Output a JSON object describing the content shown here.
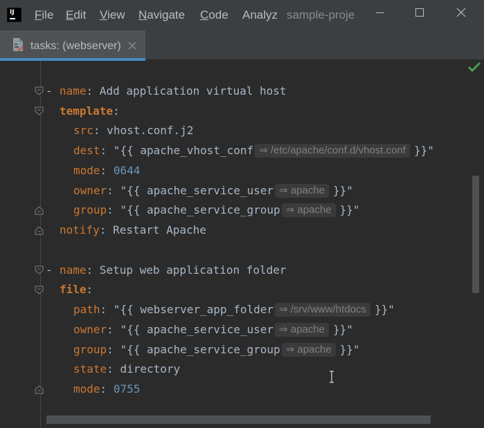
{
  "titlebar": {
    "logo_text": "IJ",
    "menu": {
      "file": {
        "mnemonic": "F",
        "rest": "ile"
      },
      "edit": {
        "mnemonic": "E",
        "rest": "dit"
      },
      "view": {
        "mnemonic": "V",
        "rest": "iew"
      },
      "navigate": {
        "mnemonic": "N",
        "rest": "avigate"
      },
      "code": {
        "mnemonic": "C",
        "rest": "ode"
      },
      "analyze": "Analyz"
    },
    "project_name": "sample-proje"
  },
  "tab": {
    "label": "tasks: (webserver)",
    "icon": "yaml-file-icon",
    "close_icon": "close-icon"
  },
  "colors": {
    "accent": "#4a88c7",
    "key": "#cc7832",
    "number": "#6897bb",
    "text": "#a9b7c6",
    "check": "#499c54"
  },
  "code": {
    "task1": {
      "dash": "-",
      "name_key": "name",
      "name_value": " Add application virtual host",
      "module": "template",
      "src_key": "src",
      "src_value": " vhost.conf.j2",
      "dest_key": "dest",
      "dest_pre": " \"{{ apache_vhost_conf",
      "dest_hint": "⇒ /etc/apache/conf.d/vhost.conf",
      "dest_post": "}}\"",
      "mode_key": "mode",
      "mode_value": "0644",
      "owner_key": "owner",
      "owner_pre": " \"{{ apache_service_user",
      "owner_hint": "⇒ apache",
      "owner_post": "}}\"",
      "group_key": "group",
      "group_pre": " \"{{ apache_service_group",
      "group_hint": "⇒ apache",
      "group_post": "}}\"",
      "notify_key": "notify",
      "notify_value": " Restart Apache"
    },
    "task2": {
      "dash": "-",
      "name_key": "name",
      "name_value": " Setup web application folder",
      "module": "file",
      "path_key": "path",
      "path_pre": " \"{{ webserver_app_folder",
      "path_hint": "⇒ /srv/www/htdocs",
      "path_post": "}}\"",
      "owner_key": "owner",
      "owner_pre": " \"{{ apache_service_user",
      "owner_hint": "⇒ apache",
      "owner_post": "}}\"",
      "group_key": "group",
      "group_pre": " \"{{ apache_service_group",
      "group_hint": "⇒ apache",
      "group_post": "}}\"",
      "state_key": "state",
      "state_value": " directory",
      "mode_key": "mode",
      "mode_value": "0755"
    },
    "colon": ":"
  }
}
